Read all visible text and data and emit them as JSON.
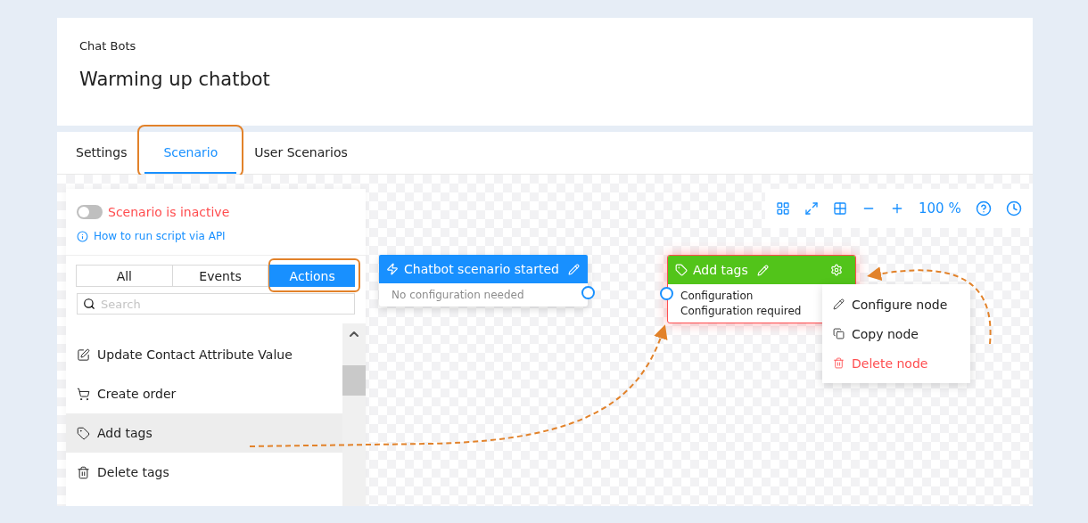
{
  "header": {
    "breadcrumb": "Chat Bots",
    "title": "Warming up chatbot"
  },
  "tabs": [
    {
      "label": "Settings",
      "selected": false,
      "highlighted": false
    },
    {
      "label": "Scenario",
      "selected": true,
      "highlighted": true
    },
    {
      "label": "User Scenarios",
      "selected": false,
      "highlighted": false
    }
  ],
  "sidebar": {
    "status": {
      "label": "Scenario is inactive",
      "on": false
    },
    "help_link": "How to run script via API",
    "filters": [
      {
        "label": "All",
        "selected": false,
        "highlighted": false
      },
      {
        "label": "Events",
        "selected": false,
        "highlighted": false
      },
      {
        "label": "Actions",
        "selected": true,
        "highlighted": true
      }
    ],
    "search": {
      "placeholder": "Search"
    },
    "items": [
      {
        "label": "Update Contact Attribute Value",
        "kind": "edit",
        "selected": false
      },
      {
        "label": "Create order",
        "kind": "cart",
        "selected": false
      },
      {
        "label": "Add tags",
        "kind": "tag",
        "selected": true
      },
      {
        "label": "Delete tags",
        "kind": "trash",
        "selected": false
      }
    ]
  },
  "toolbar": {
    "zoom": "100 %"
  },
  "nodes": [
    {
      "kind": "trigger",
      "title": "Chatbot scenario started",
      "body": [
        "No configuration needed"
      ],
      "error": false
    },
    {
      "kind": "action",
      "title": "Add tags",
      "body": [
        "Configuration",
        "Configuration required"
      ],
      "error": true
    }
  ],
  "context_menu": [
    {
      "label": "Configure node",
      "kind": "configure"
    },
    {
      "label": "Copy node",
      "kind": "copy"
    },
    {
      "label": "Delete node",
      "kind": "delete"
    }
  ]
}
